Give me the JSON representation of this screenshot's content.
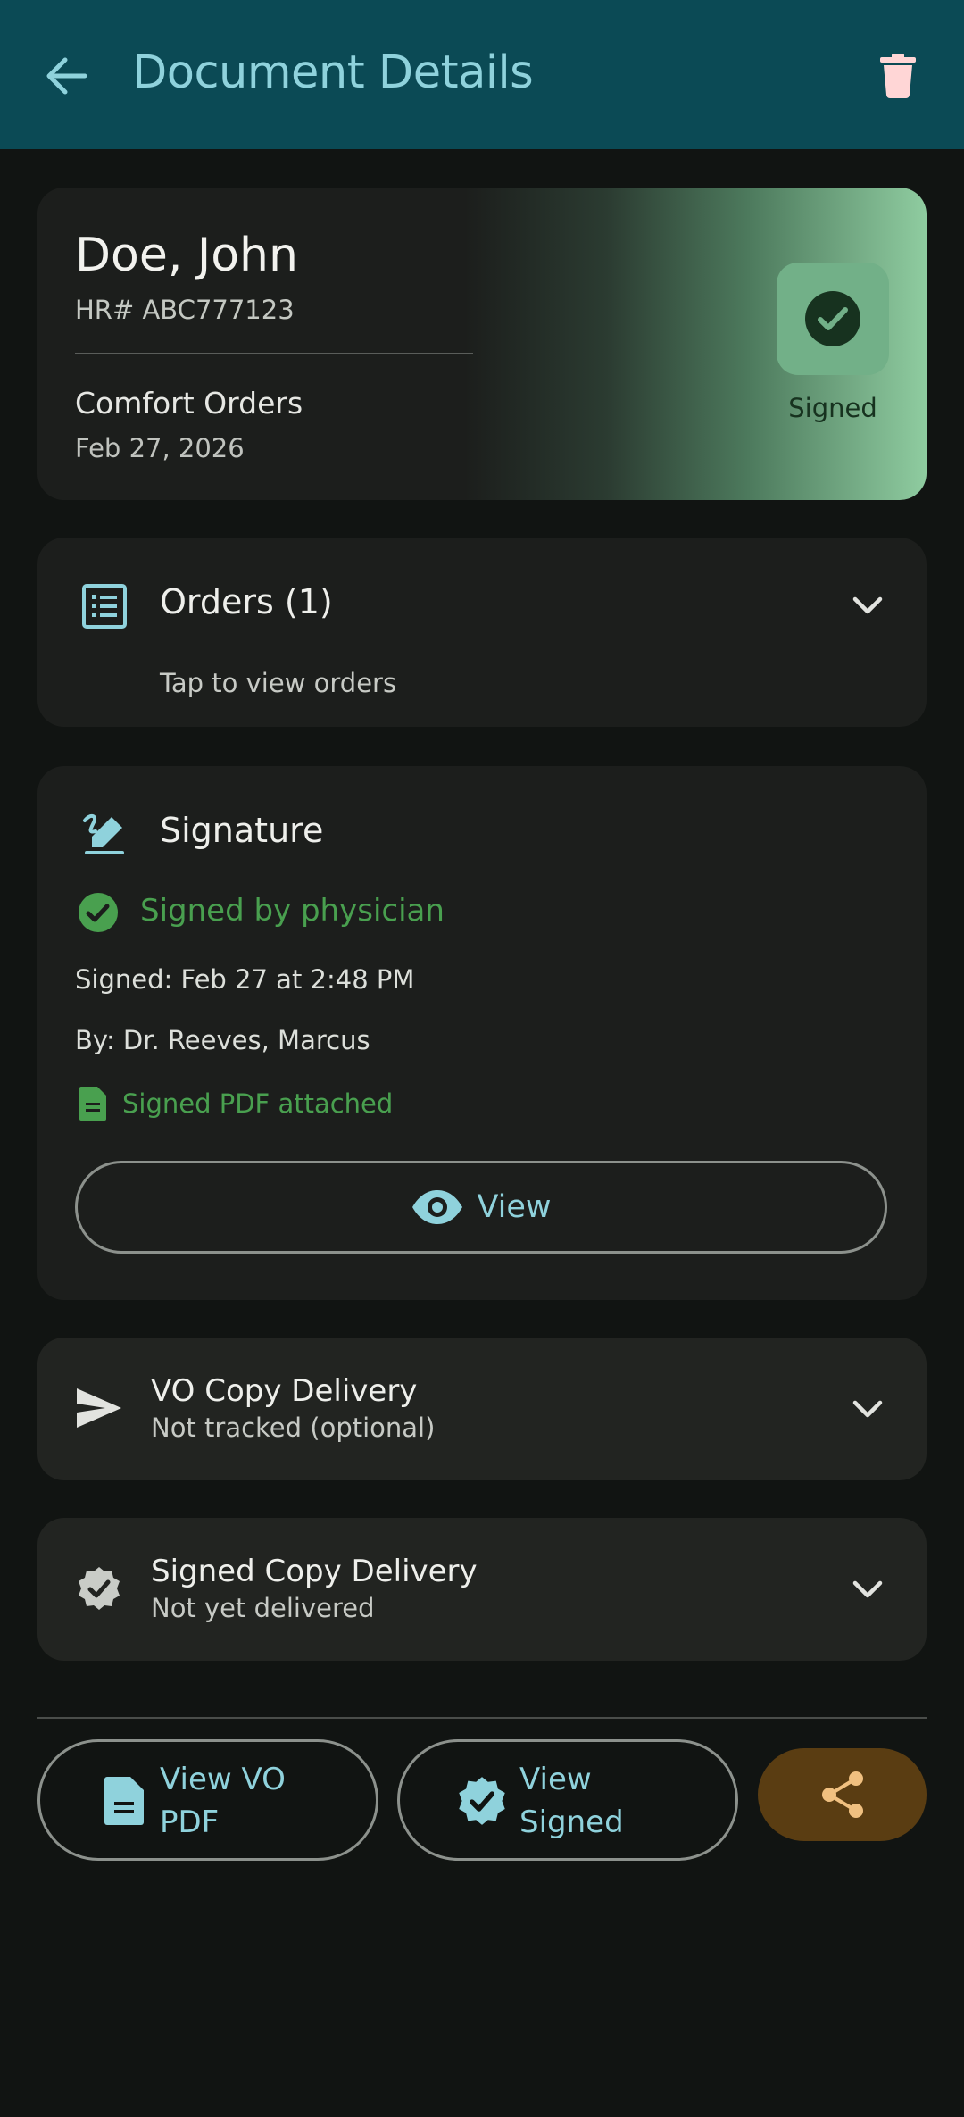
{
  "appbar": {
    "title": "Document Details",
    "back_icon": "arrow-back-icon",
    "delete_icon": "trash-icon"
  },
  "hero": {
    "patient_name": "Doe, John",
    "hr_number": "HR# ABC777123",
    "document_type": "Comfort Orders",
    "date": "Feb 27, 2026",
    "status": "Signed",
    "status_icon": "check-circle-icon"
  },
  "orders": {
    "title": "Orders (1)",
    "hint": "Tap to view orders",
    "icon": "list-icon"
  },
  "signature": {
    "title": "Signature",
    "icon": "signature-pen-icon",
    "status_text": "Signed by physician",
    "signed_at": "Signed: Feb 27 at 2:48 PM",
    "signed_by": "By: Dr. Reeves, Marcus",
    "pdf_status": "Signed PDF attached",
    "view_label": "View"
  },
  "vo_delivery": {
    "title": "VO Copy Delivery",
    "subtitle": "Not tracked (optional)",
    "icon": "send-icon"
  },
  "signed_delivery": {
    "title": "Signed Copy Delivery",
    "subtitle": "Not yet delivered",
    "icon": "verified-badge-icon"
  },
  "actions": {
    "view_vo_pdf_line1": "View VO",
    "view_vo_pdf_line2": "PDF",
    "view_signed_line1": "View",
    "view_signed_line2": "Signed",
    "share_icon": "share-icon"
  },
  "colors": {
    "appbar_bg": "#0b4a55",
    "accent_teal": "#8fd2dc",
    "success_green": "#49a04f",
    "share_bg": "#5a3d12",
    "share_fg": "#f0c080",
    "trash_color": "#ffd6d6"
  }
}
